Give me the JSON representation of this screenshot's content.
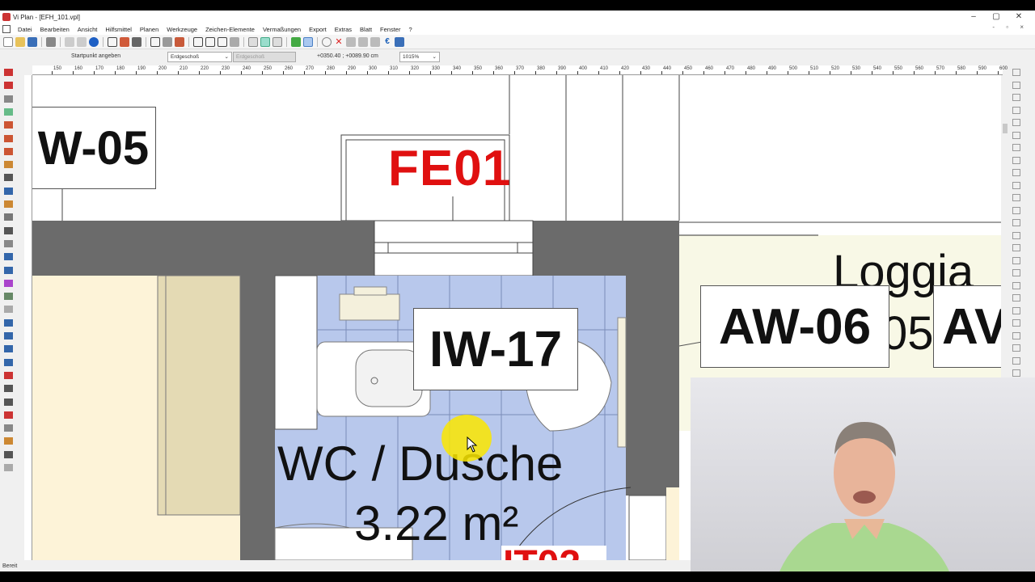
{
  "window": {
    "title": "Vi Plan - [EFH_101.vpl]",
    "controls": [
      "–",
      "▢",
      "✕"
    ]
  },
  "menu": {
    "items": [
      "Datei",
      "Bearbeiten",
      "Ansicht",
      "Hilfsmittel",
      "Planen",
      "Werkzeuge",
      "Zeichen-Elemente",
      "Vermaßungen",
      "Export",
      "Extras",
      "Blatt",
      "Fenster",
      "?"
    ],
    "mdi_controls": "- ▫ ×"
  },
  "infobar": {
    "hint": "Startpunkt angeben",
    "floor_select": "Erdgeschoß",
    "floor_select_disabled": "Erdgeschoß",
    "coords": "+0350.40 ; +0089.90 cm",
    "zoom": "1015%"
  },
  "ruler": {
    "labels": [
      "150",
      "160",
      "170",
      "180",
      "190",
      "200",
      "210",
      "220",
      "230",
      "240",
      "250",
      "260",
      "270",
      "280",
      "290",
      "300",
      "310",
      "320",
      "330",
      "340",
      "350",
      "360",
      "370",
      "380",
      "390",
      "400",
      "410",
      "420",
      "430",
      "440",
      "450",
      "460",
      "470",
      "480",
      "490",
      "500",
      "510",
      "520",
      "530",
      "540",
      "550",
      "560",
      "570",
      "580",
      "590",
      "600"
    ]
  },
  "plan": {
    "label_w05": "W-05",
    "label_fe01": "FE01",
    "label_iw17": "IW-17",
    "label_aw06": "AW-06",
    "label_aw_partial": "AV",
    "room_name": "WC / Dusche",
    "room_area": "3.22 m²",
    "loggia_name": "Loggia",
    "loggia_partial": "05",
    "partial_bottom_red": "IT02",
    "colors": {
      "wall": "#6b6b6b",
      "bath_floor": "#b8c8ec",
      "room_beige": "#fdf3d8",
      "loggia_bg": "#f8f8e6",
      "label_red": "#e01010"
    }
  },
  "statusbar": {
    "text": "Bereit"
  }
}
